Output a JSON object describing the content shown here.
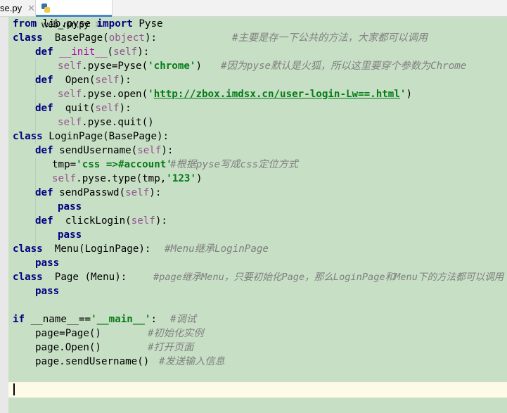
{
  "tabs": [
    {
      "label": "se.py",
      "close": "✕"
    },
    {
      "label": "web_run.py",
      "close": "✕"
    }
  ],
  "code": {
    "l1": [
      "from",
      " lib.pyse ",
      "import",
      " Pyse"
    ],
    "l2": [
      "class",
      "  BasePage(",
      "object",
      "):",
      "#主要是存一下公共的方法，大家都可以调用"
    ],
    "l3": [
      "def",
      " ",
      "__init__",
      "(",
      "self",
      "):"
    ],
    "l4": [
      "self",
      ".pyse=Pyse(",
      "'chrome'",
      ")",
      "#因为pyse默认是火狐，所以这里要穿个参数为Chrome"
    ],
    "l5": [
      "def",
      "  Open(",
      "self",
      "):"
    ],
    "l6": [
      "self",
      ".pyse.open(",
      "'",
      "http://zbox.imdsx.cn/user-login-Lw==.html",
      "'",
      ")"
    ],
    "l7": [
      "def",
      "  quit(",
      "self",
      "):"
    ],
    "l8": [
      "self",
      ".pyse.quit()"
    ],
    "l9": [
      "class",
      " LoginPage(BasePage):"
    ],
    "l10": [
      "def",
      " sendUsername(",
      "self",
      "):"
    ],
    "l11": [
      "tmp=",
      "'css =>#account'",
      "#根据pyse写成css定位方式"
    ],
    "l12": [
      "self",
      ".pyse.type(tmp,",
      "'123'",
      ")"
    ],
    "l13": [
      "def",
      " sendPasswd(",
      "self",
      "):"
    ],
    "l14": [
      "pass"
    ],
    "l15": [
      "def",
      "  clickLogin(",
      "self",
      "):"
    ],
    "l16": [
      "pass"
    ],
    "l17": [
      "class",
      "  Menu(LoginPage):",
      "#Menu继承LoginPage"
    ],
    "l18": [
      "pass"
    ],
    "l19": [
      "class",
      "  Page (Menu):",
      "#page继承Menu，只要初始化Page，那么LoginPage和Menu下的方法都可以调用"
    ],
    "l20": [
      "pass"
    ],
    "l22": [
      "if",
      " __name__==",
      "'__main__'",
      ":",
      "#调试"
    ],
    "l23": [
      "page=Page()",
      "#初始化实例"
    ],
    "l24": [
      "page.Open()",
      "#打开页面"
    ],
    "l25": [
      "page.sendUsername()",
      "#发送输入信息"
    ]
  }
}
